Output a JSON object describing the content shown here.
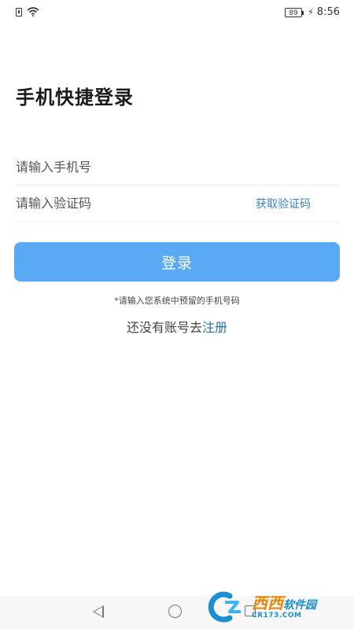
{
  "status_bar": {
    "battery_level": "89",
    "time": "8:56"
  },
  "page": {
    "title": "手机快捷登录"
  },
  "form": {
    "phone_placeholder": "请输入手机号",
    "code_placeholder": "请输入验证码",
    "get_code_label": "获取验证码",
    "login_label": "登录",
    "hint": "*请输入您系统中预留的手机号码",
    "register_prefix": "还没有账号去",
    "register_link": "注册"
  },
  "watermark": {
    "main": "西西",
    "secondary": "软件园",
    "sub": "CR173.COM"
  },
  "colors": {
    "accent": "#5aa9f5",
    "link": "#1f6fb5",
    "get_code": "#3b82c4"
  }
}
